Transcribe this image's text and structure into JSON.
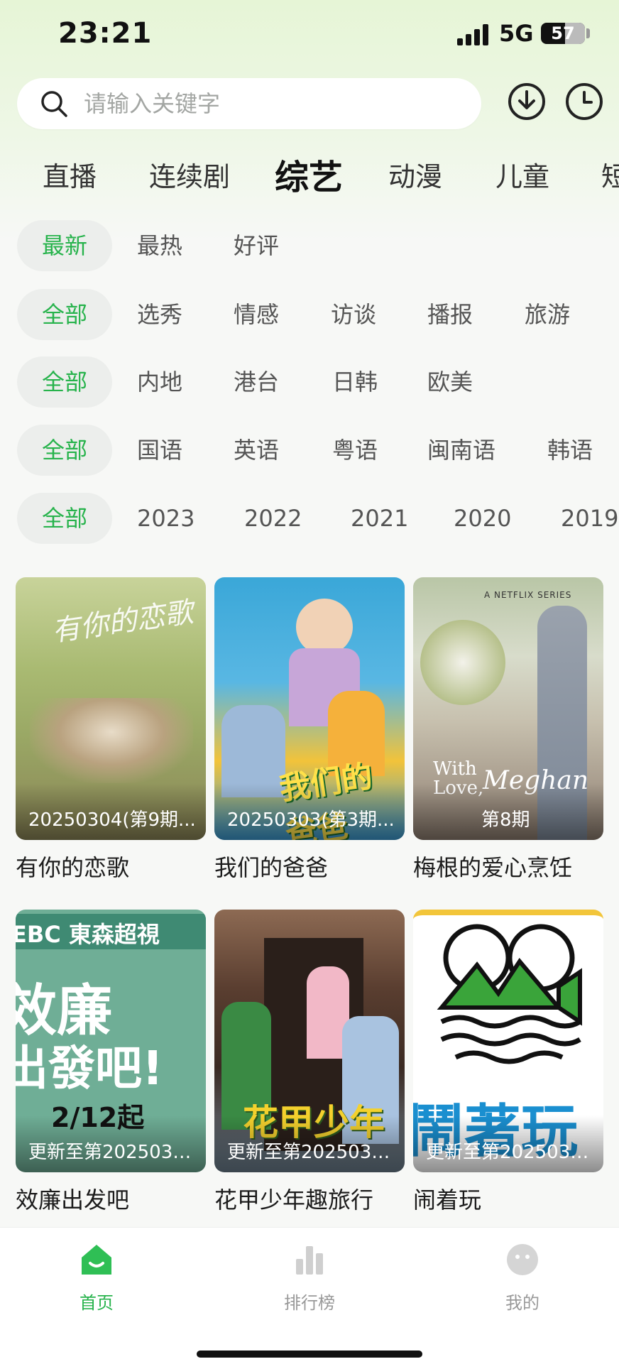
{
  "status_bar": {
    "time": "23:21",
    "network": "5G",
    "battery": "57"
  },
  "search": {
    "placeholder": "请输入关键字"
  },
  "categories": [
    "直播",
    "连续剧",
    "综艺",
    "动漫",
    "儿童",
    "短"
  ],
  "active_category": "综艺",
  "filters": {
    "sort": [
      "最新",
      "最热",
      "好评"
    ],
    "genre": [
      "全部",
      "选秀",
      "情感",
      "访谈",
      "播报",
      "旅游"
    ],
    "region": [
      "全部",
      "内地",
      "港台",
      "日韩",
      "欧美"
    ],
    "language": [
      "全部",
      "国语",
      "英语",
      "粤语",
      "闽南语",
      "韩语"
    ],
    "year": [
      "全部",
      "2023",
      "2022",
      "2021",
      "2020",
      "2019"
    ]
  },
  "shows": [
    {
      "title": "有你的恋歌",
      "tag": "20250304(第9期..."
    },
    {
      "title": "我们的爸爸",
      "tag": "20250303(第3期..."
    },
    {
      "title": "梅根的爱心烹饪",
      "tag": "第8期"
    },
    {
      "title": "效廉出发吧",
      "tag": "更新至第2025030..."
    },
    {
      "title": "花甲少年趣旅行",
      "tag": "更新至第2025030..."
    },
    {
      "title": "闹着玩",
      "tag": "更新至第2025030..."
    }
  ],
  "poster_text": {
    "p1_title": "有你的恋歌",
    "p2_title": "我们的爸爸",
    "p3_series": "A NETFLIX SERIES",
    "p3_title1": "With",
    "p3_title2": "Love,",
    "p3_title3": "Meghan",
    "p4_brand": "EBC 東森超視",
    "p4_line1": "效廉",
    "p4_line2": "出發吧!",
    "p4_date": "2/12起",
    "p5_title": "花甲少年",
    "p6_title": "鬧著玩"
  },
  "tabbar": [
    "首页",
    "排行榜",
    "我的"
  ],
  "colors": {
    "accent": "#27b34c",
    "header_bg": "#e6f5d6",
    "chip_bg": "#eceeec"
  }
}
